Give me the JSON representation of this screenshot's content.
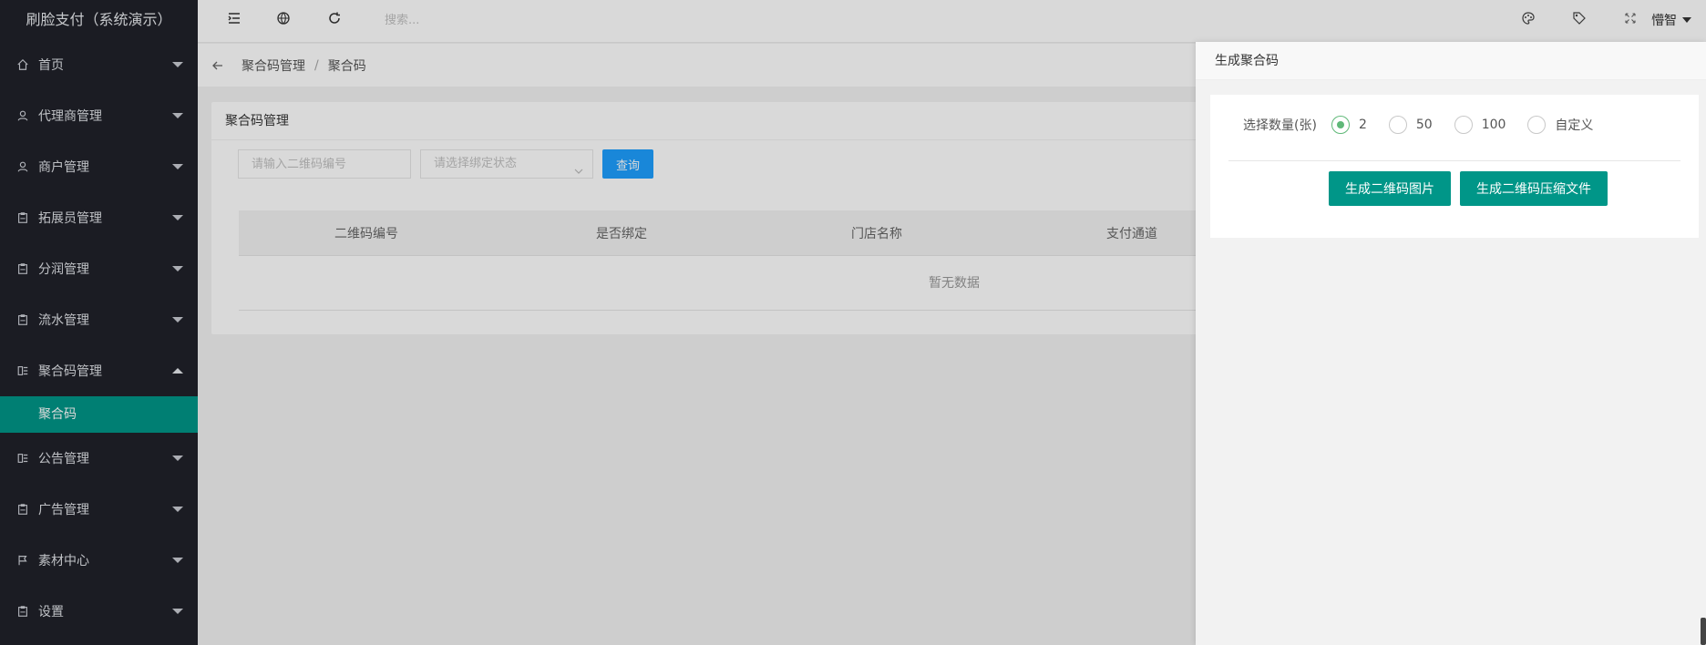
{
  "sidebar": {
    "logo": "刷脸支付（系统演示）",
    "items": [
      {
        "label": "首页",
        "icon": "home-icon"
      },
      {
        "label": "代理商管理",
        "icon": "user-icon"
      },
      {
        "label": "商户管理",
        "icon": "user-icon"
      },
      {
        "label": "拓展员管理",
        "icon": "clipboard-icon"
      },
      {
        "label": "分润管理",
        "icon": "clipboard-icon"
      },
      {
        "label": "流水管理",
        "icon": "clipboard-icon"
      },
      {
        "label": "聚合码管理",
        "icon": "app-icon",
        "expanded": true
      },
      {
        "label": "公告管理",
        "icon": "app-icon"
      },
      {
        "label": "广告管理",
        "icon": "clipboard-icon"
      },
      {
        "label": "素材中心",
        "icon": "flag-icon"
      },
      {
        "label": "设置",
        "icon": "clipboard-icon"
      }
    ],
    "submenu": {
      "active": "聚合码"
    }
  },
  "header": {
    "search_placeholder": "搜索...",
    "username": "懵智",
    "icons": [
      "menu-fold-icon",
      "website-icon",
      "refresh-icon",
      "palette-icon",
      "tag-icon",
      "fullscreen-icon"
    ]
  },
  "breadcrumb": {
    "items": [
      "聚合码管理",
      "聚合码"
    ],
    "separator": "/"
  },
  "card": {
    "title": "聚合码管理",
    "code_input_placeholder": "请输入二维码编号",
    "bind_select_placeholder": "请选择绑定状态",
    "query_button": "查询",
    "table": {
      "columns": [
        "二维码编号",
        "是否绑定",
        "门店名称",
        "支付通道"
      ],
      "empty_text": "暂无数据"
    }
  },
  "drawer": {
    "title": "生成聚合码",
    "quantity_label": "选择数量(张)",
    "options": [
      {
        "label": "2",
        "checked": true
      },
      {
        "label": "50",
        "checked": false
      },
      {
        "label": "100",
        "checked": false
      },
      {
        "label": "自定义",
        "checked": false
      }
    ],
    "btn_image": "生成二维码图片",
    "btn_zip": "生成二维码压缩文件"
  },
  "colors": {
    "sidebar_bg": "#20222a",
    "accent_green": "#009688",
    "accent_blue": "#1e9fff",
    "radio_green": "#5fb878"
  }
}
